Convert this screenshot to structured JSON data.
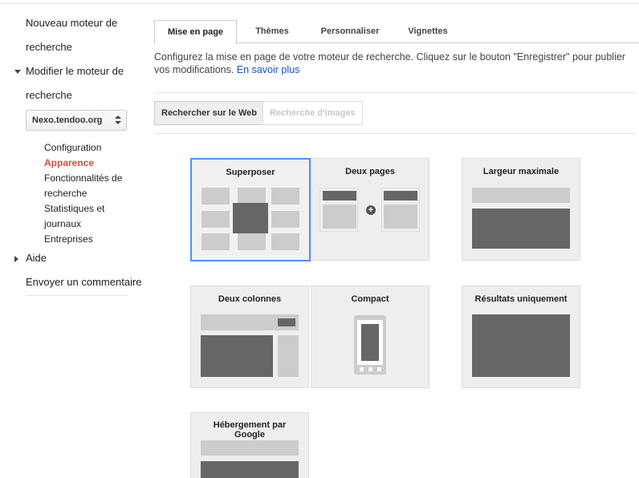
{
  "sidebar": {
    "items": [
      {
        "label_line1": "Nouveau moteur de",
        "label_line2": "recherche"
      },
      {
        "label_line1": "Modifier le moteur de",
        "label_line2": "recherche"
      }
    ],
    "engine_select": {
      "value": "Nexo.tendoo.org"
    },
    "subitems": {
      "configuration": "Configuration",
      "apparence": "Apparence",
      "fonctionnalites_1": "Fonctionnalités de",
      "fonctionnalites_2": "recherche",
      "statistiques_1": "Statistiques et",
      "statistiques_2": "journaux",
      "entreprises": "Entreprises"
    },
    "aide": "Aide",
    "feedback": "Envoyer un commentaire"
  },
  "tabs": [
    {
      "label": "Mise en page",
      "active": true
    },
    {
      "label": "Thèmes",
      "active": false
    },
    {
      "label": "Personnaliser",
      "active": false
    },
    {
      "label": "Vignettes",
      "active": false
    }
  ],
  "description": {
    "text": "Configurez la mise en page de votre moteur de recherche. Cliquez sur le bouton \"Enregistrer\" pour publier vos modifications.",
    "link": "En savoir plus"
  },
  "segments": {
    "web": "Rechercher sur le Web",
    "images": "Recherche d'images"
  },
  "layouts": {
    "superposer": "Superposer",
    "deux_pages": "Deux pages",
    "largeur_maximale": "Largeur maximale",
    "deux_colonnes": "Deux colonnes",
    "compact": "Compact",
    "resultats_uniquement": "Résultats uniquement",
    "hebergement": "Hébergement par Google",
    "selected": "Superposer"
  },
  "colors": {
    "accent": "#4d90fe",
    "active_nav": "#dd4b39",
    "link": "#1155cc"
  }
}
